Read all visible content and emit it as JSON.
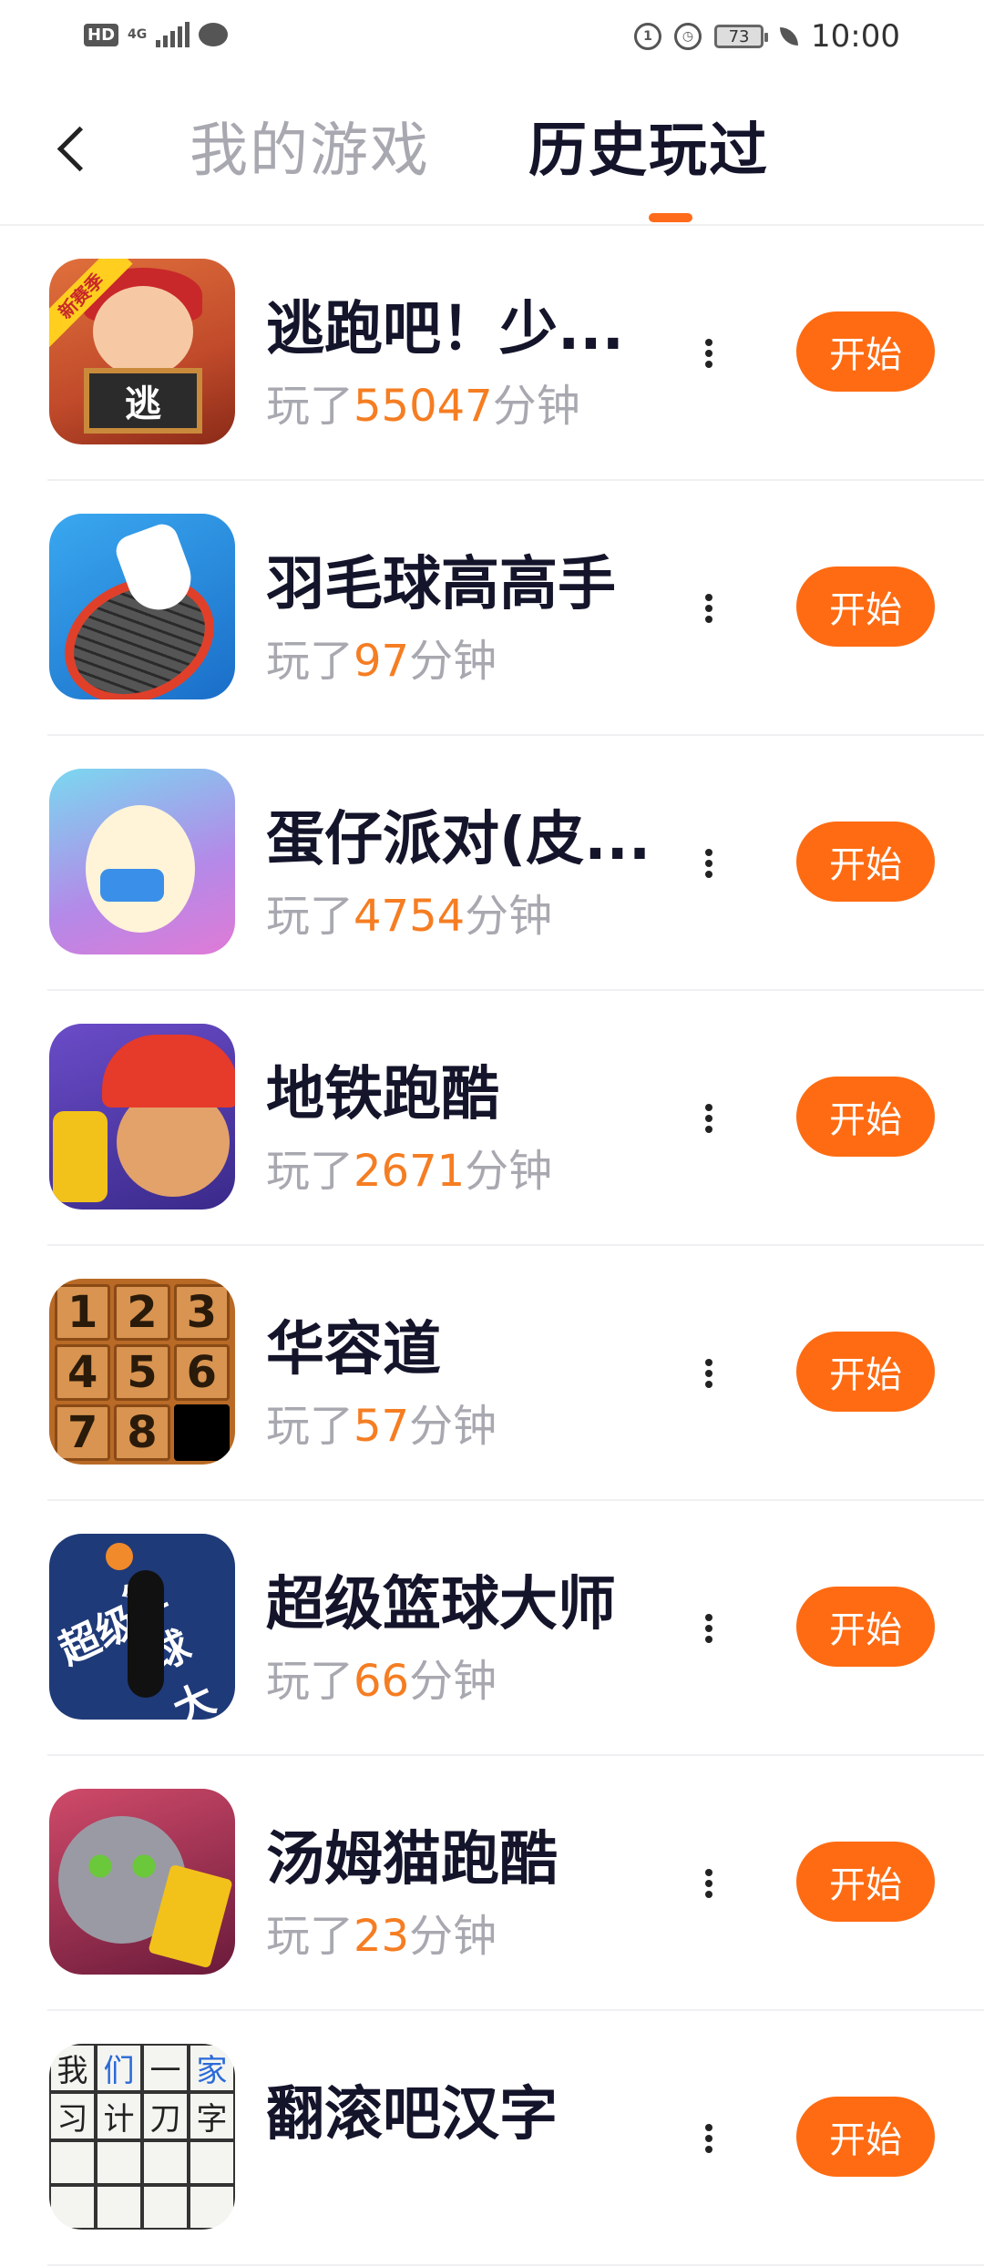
{
  "status_bar": {
    "hd": "HD",
    "network": "4G",
    "battery": "73",
    "time": "10:00"
  },
  "header": {
    "tabs": [
      {
        "label": "我的游戏",
        "active": false
      },
      {
        "label": "历史玩过",
        "active": true
      }
    ],
    "accent_color": "#ff6b12"
  },
  "games": [
    {
      "name": "逃跑吧！少...",
      "played_prefix": "玩了",
      "minutes": "55047",
      "played_suffix": "分钟",
      "button": "开始",
      "icon": "escape-game-icon",
      "icon_ribbon": "新赛季",
      "icon_board": "逃"
    },
    {
      "name": "羽毛球高高手",
      "played_prefix": "玩了",
      "minutes": "97",
      "played_suffix": "分钟",
      "button": "开始",
      "icon": "badminton-game-icon"
    },
    {
      "name": "蛋仔派对(皮...",
      "played_prefix": "玩了",
      "minutes": "4754",
      "played_suffix": "分钟",
      "button": "开始",
      "icon": "eggy-party-game-icon"
    },
    {
      "name": "地铁跑酷",
      "played_prefix": "玩了",
      "minutes": "2671",
      "played_suffix": "分钟",
      "button": "开始",
      "icon": "subway-surfers-game-icon"
    },
    {
      "name": "华容道",
      "played_prefix": "玩了",
      "minutes": "57",
      "played_suffix": "分钟",
      "button": "开始",
      "icon": "sliding-puzzle-game-icon",
      "tiles": [
        "1",
        "2",
        "3",
        "4",
        "5",
        "6",
        "7",
        "8",
        ""
      ]
    },
    {
      "name": "超级篮球大师",
      "played_prefix": "玩了",
      "minutes": "66",
      "played_suffix": "分钟",
      "button": "开始",
      "icon": "basketball-game-icon",
      "icon_text_1": "超级",
      "icon_text_2": "篮球大师"
    },
    {
      "name": "汤姆猫跑酷",
      "played_prefix": "玩了",
      "minutes": "23",
      "played_suffix": "分钟",
      "button": "开始",
      "icon": "tom-cat-runner-game-icon"
    },
    {
      "name": "翻滚吧汉字",
      "played_prefix": "",
      "minutes": "",
      "played_suffix": "",
      "button": "开始",
      "icon": "chinese-character-game-icon",
      "cells": [
        "我",
        "们",
        "一",
        "家",
        "习",
        "计",
        "刀",
        "字",
        "",
        "",
        "",
        "",
        "",
        "",
        "",
        ""
      ]
    }
  ]
}
